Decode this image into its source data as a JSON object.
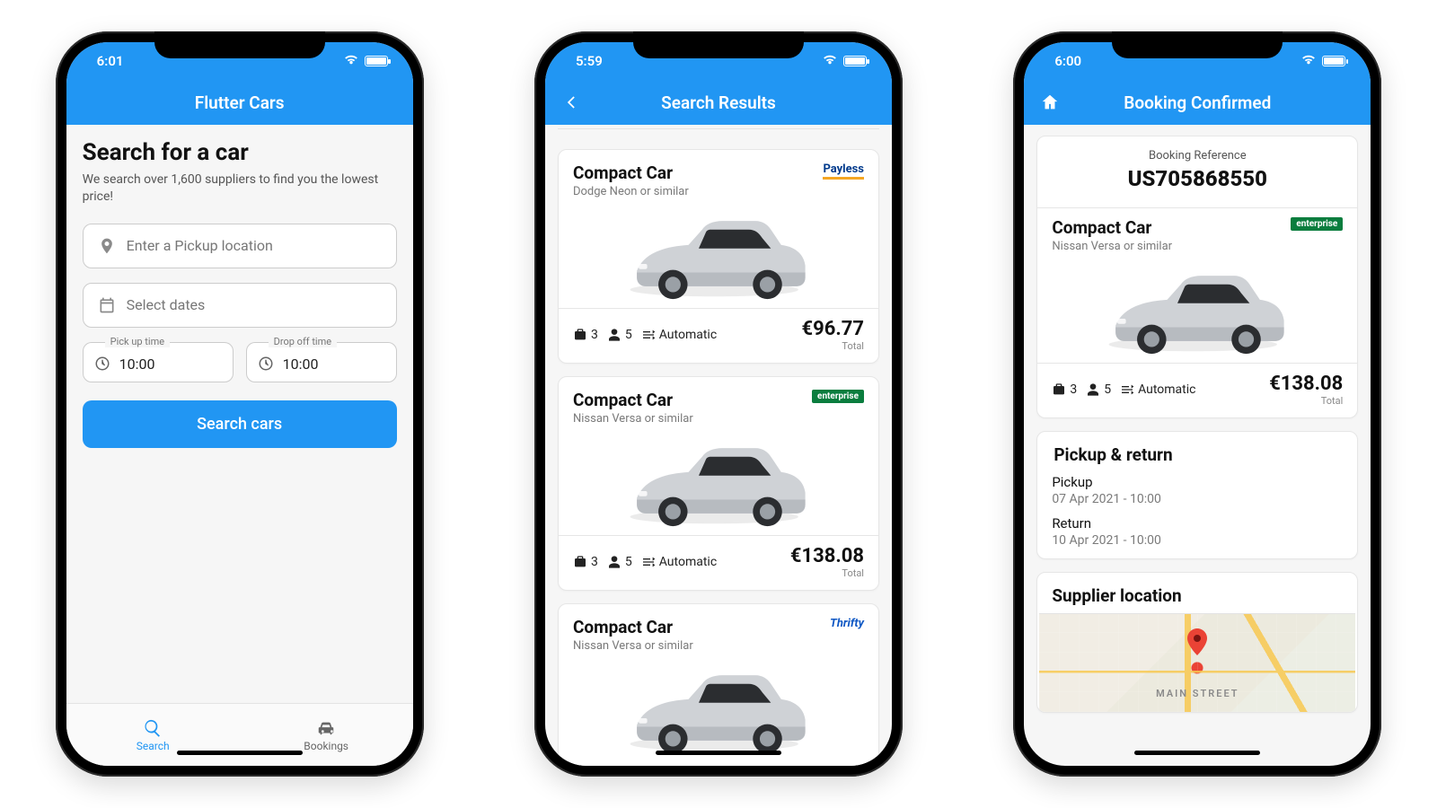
{
  "screen1": {
    "status_time": "6:01",
    "app_title": "Flutter Cars",
    "heading": "Search for a car",
    "subheading": "We search over 1,600 suppliers to find you the lowest price!",
    "pickup_placeholder": "Enter a Pickup location",
    "dates_placeholder": "Select dates",
    "pickup_time_label": "Pick up time",
    "pickup_time_value": "10:00",
    "dropoff_time_label": "Drop off time",
    "dropoff_time_value": "10:00",
    "search_button": "Search cars",
    "nav_search": "Search",
    "nav_bookings": "Bookings"
  },
  "screen2": {
    "status_time": "5:59",
    "app_title": "Search Results",
    "total_label": "Total",
    "results": [
      {
        "title": "Compact Car",
        "subtitle": "Dodge Neon or similar",
        "supplier_name": "Payless",
        "supplier_class": "payless",
        "bags": "3",
        "seats": "5",
        "transmission": "Automatic",
        "price": "€96.77"
      },
      {
        "title": "Compact Car",
        "subtitle": "Nissan Versa or similar",
        "supplier_name": "enterprise",
        "supplier_class": "enterprise",
        "bags": "3",
        "seats": "5",
        "transmission": "Automatic",
        "price": "€138.08"
      },
      {
        "title": "Compact Car",
        "subtitle": "Nissan Versa or similar",
        "supplier_name": "Thrifty",
        "supplier_class": "thrifty",
        "bags": "",
        "seats": "",
        "transmission": "",
        "price": ""
      }
    ]
  },
  "screen3": {
    "status_time": "6:00",
    "app_title": "Booking Confirmed",
    "ref_label": "Booking Reference",
    "ref_value": "US705868550",
    "car": {
      "title": "Compact Car",
      "subtitle": "Nissan Versa or similar",
      "supplier_name": "enterprise",
      "supplier_class": "enterprise",
      "bags": "3",
      "seats": "5",
      "transmission": "Automatic",
      "price": "€138.08",
      "total_label": "Total"
    },
    "pr_title": "Pickup & return",
    "pickup_label": "Pickup",
    "pickup_value": "07 Apr 2021 - 10:00",
    "return_label": "Return",
    "return_value": "10 Apr 2021 - 10:00",
    "supplier_loc_title": "Supplier location",
    "map_label": "MAIN STREET"
  }
}
